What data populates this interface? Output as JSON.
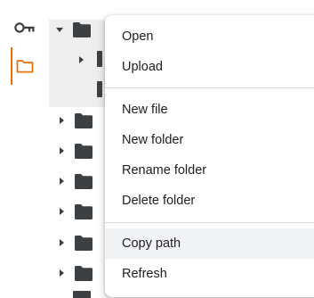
{
  "rail": {
    "items": [
      {
        "icon": "key-icon"
      },
      {
        "icon": "folder-icon",
        "active": true
      }
    ],
    "accent": "#e8710a"
  },
  "tree": {
    "rows": [
      {
        "icon": "folder-icon",
        "expanded": true,
        "selected": true
      },
      {
        "icon": "folder-icon",
        "expanded": false
      },
      {
        "icon": "folder-icon",
        "expanded": false
      },
      {
        "icon": "folder-icon",
        "expanded": false
      },
      {
        "icon": "folder-icon",
        "expanded": false
      },
      {
        "icon": "folder-icon",
        "expanded": false
      },
      {
        "icon": "folder-icon",
        "expanded": false
      },
      {
        "icon": "folder-icon",
        "expanded": false
      }
    ]
  },
  "menu": {
    "items": [
      {
        "label": "Open"
      },
      {
        "label": "Upload"
      },
      {
        "label": "New file"
      },
      {
        "label": "New folder"
      },
      {
        "label": "Rename folder"
      },
      {
        "label": "Delete folder"
      },
      {
        "label": "Copy path",
        "hover": true
      },
      {
        "label": "Refresh"
      }
    ]
  }
}
